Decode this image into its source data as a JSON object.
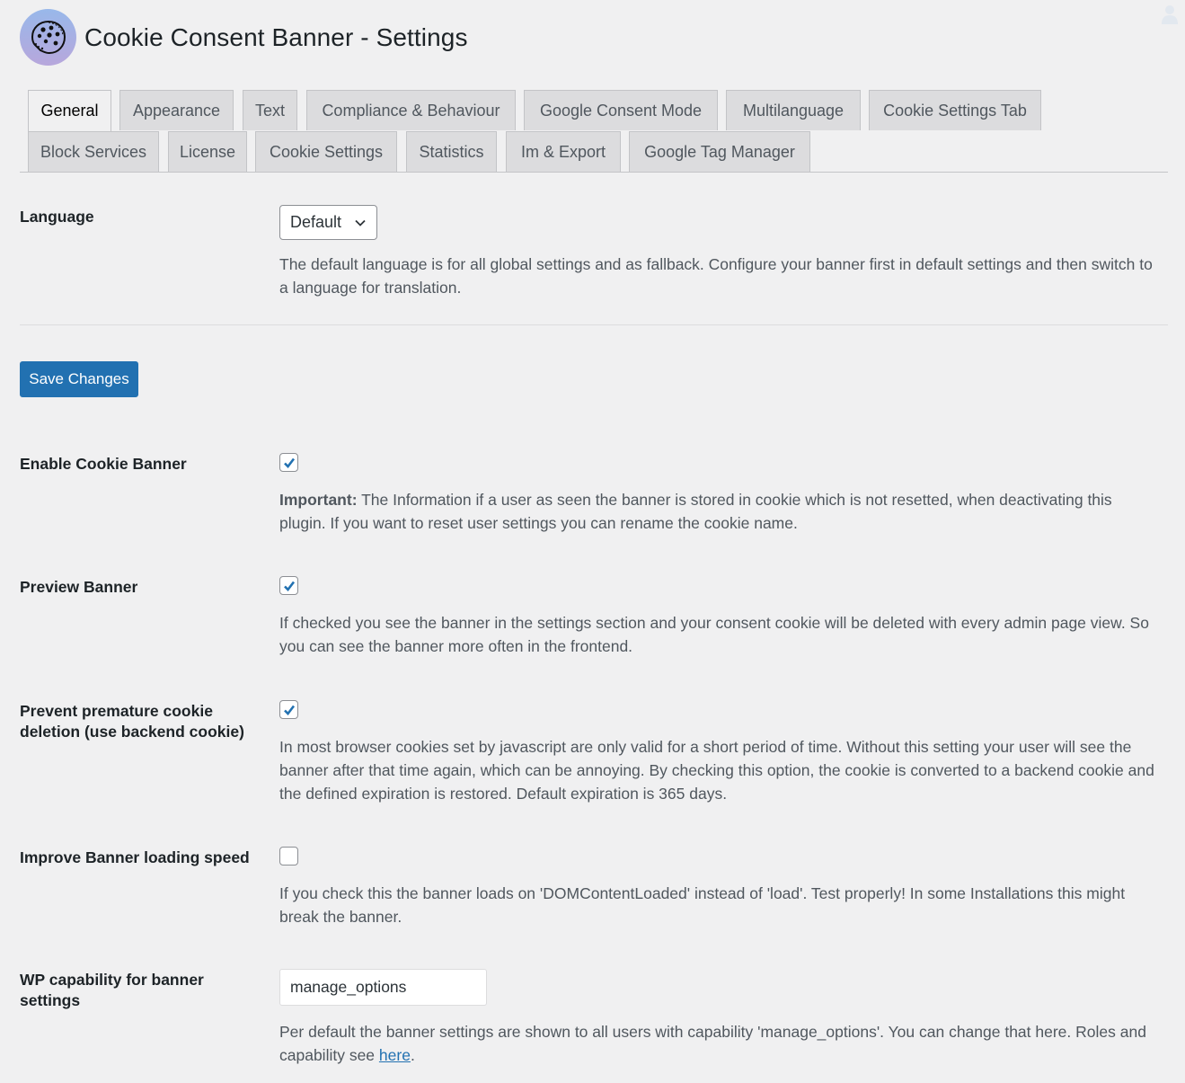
{
  "header": {
    "title": "Cookie Consent Banner - Settings",
    "logo_icon": "cookie-icon",
    "user_icon": "user-avatar-icon"
  },
  "tabs": [
    {
      "label": "General",
      "active": true
    },
    {
      "label": "Appearance",
      "active": false
    },
    {
      "label": "Text",
      "active": false
    },
    {
      "label": "Compliance & Behaviour",
      "active": false
    },
    {
      "label": "Google Consent Mode",
      "active": false
    },
    {
      "label": "Multilanguage",
      "active": false
    },
    {
      "label": "Cookie Settings Tab",
      "active": false
    },
    {
      "label": "Block Services",
      "active": false
    },
    {
      "label": "License",
      "active": false
    },
    {
      "label": "Cookie Settings",
      "active": false
    },
    {
      "label": "Statistics",
      "active": false
    },
    {
      "label": "Im & Export",
      "active": false
    },
    {
      "label": "Google Tag Manager",
      "active": false
    }
  ],
  "language": {
    "label": "Language",
    "selected": "Default",
    "description": "The default language is for all global settings and as fallback. Configure your banner first in default settings and then switch to a language for translation."
  },
  "save_button": {
    "label": "Save Changes"
  },
  "settings": {
    "enable_banner": {
      "label": "Enable Cookie Banner",
      "checked": true,
      "description_strong": "Important:",
      "description": " The Information if a user as seen the banner is stored in cookie which is not resetted, when deactivating this plugin. If you want to reset user settings you can rename the cookie name."
    },
    "preview_banner": {
      "label": "Preview Banner",
      "checked": true,
      "description": "If checked you see the banner in the settings section and your consent cookie will be deleted with every admin page view. So you can see the banner more often in the frontend."
    },
    "prevent_deletion": {
      "label": "Prevent premature cookie deletion (use backend cookie)",
      "checked": true,
      "description": "In most browser cookies set by javascript are only valid for a short period of time. Without this setting your user will see the banner after that time again, which can be annoying. By checking this option, the cookie is converted to a backend cookie and the defined expiration is restored. Default expiration is 365 days."
    },
    "improve_speed": {
      "label": "Improve Banner loading speed",
      "checked": false,
      "description": "If you check this the banner loads on 'DOMContentLoaded' instead of 'load'. Test properly! In some Installations this might break the banner."
    },
    "wp_capability": {
      "label": "WP capability for banner settings",
      "value": "manage_options",
      "description": "Per default the banner settings are shown to all users with capability 'manage_options'. You can change that here. Roles and capability see ",
      "link_text": "here",
      "description_end": "."
    }
  },
  "colors": {
    "primary": "#2271b1",
    "background": "#f0f0f1",
    "tab_inactive": "#dcdcde",
    "description_text": "#50575e"
  }
}
